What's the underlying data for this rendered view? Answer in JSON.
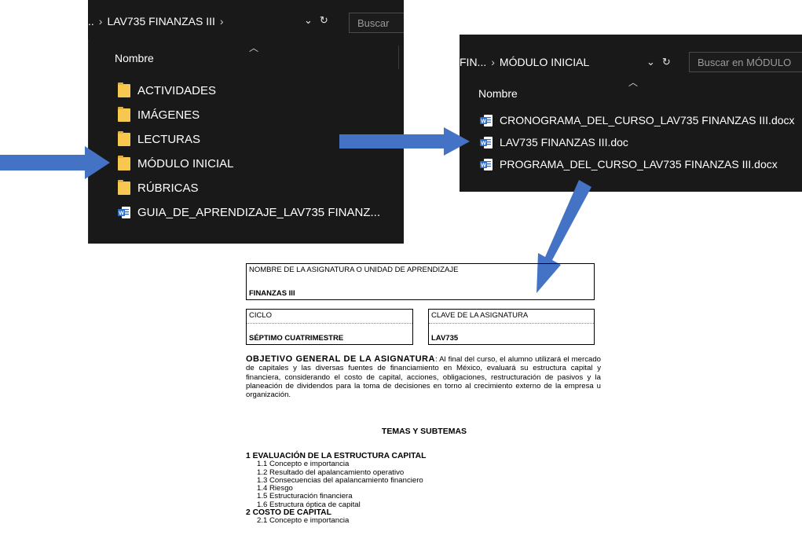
{
  "explorer1": {
    "breadcrumb_prev": "..",
    "breadcrumb_current": "LAV735 FINANZAS III",
    "search_placeholder": "Buscar",
    "column_name": "Nombre",
    "items": [
      {
        "label": "ACTIVIDADES",
        "icon": "folder-icon"
      },
      {
        "label": "IMÁGENES",
        "icon": "folder-icon"
      },
      {
        "label": "LECTURAS",
        "icon": "folder-icon"
      },
      {
        "label": "MÓDULO INICIAL",
        "icon": "folder-icon"
      },
      {
        "label": "RÚBRICAS",
        "icon": "folder-icon"
      },
      {
        "label": "GUIA_DE_APRENDIZAJE_LAV735 FINANZ...",
        "icon": "word-document-icon"
      }
    ]
  },
  "explorer2": {
    "breadcrumb_prev": "FIN...",
    "breadcrumb_current": "MÓDULO INICIAL",
    "search_placeholder": "Buscar en MÓDULO",
    "column_name": "Nombre",
    "items": [
      {
        "label": "CRONOGRAMA_DEL_CURSO_LAV735 FINANZAS III.docx",
        "icon": "word-document-icon"
      },
      {
        "label": "LAV735 FINANZAS III.doc",
        "icon": "word-document-icon"
      },
      {
        "label": "PROGRAMA_DEL_CURSO_LAV735 FINANZAS III.docx",
        "icon": "word-document-icon"
      }
    ]
  },
  "document": {
    "subject_label": "NOMBRE DE LA ASIGNATURA O UNIDAD DE APRENDIZAJE",
    "subject_value": "FINANZAS III",
    "cycle_label": "CICLO",
    "cycle_value": "SÉPTIMO CUATRIMESTRE",
    "code_label": "CLAVE DE LA ASIGNATURA",
    "code_value": "LAV735",
    "objective_heading": "OBJETIVO GENERAL DE LA ASIGNATURA",
    "objective_text": ": Al final del curso, el alumno utilizará el mercado de capitales y las diversas fuentes de financiamiento en México, evaluará su estructura capital y financiera, considerando el costo de capital, acciones, obligaciones, restructuración de pasivos y la planeación de dividendos para la toma de decisiones en torno al crecimiento externo de la empresa u organización.",
    "topics_title": "TEMAS Y SUBTEMAS",
    "topics": [
      {
        "text": "1  EVALUACIÓN DE LA ESTRUCTURA CAPITAL",
        "main": true
      },
      {
        "text": "1.1  Concepto e importancia",
        "main": false
      },
      {
        "text": "1.2  Resultado del apalancamiento operativo",
        "main": false
      },
      {
        "text": "1.3  Consecuencias del apalancamiento financiero",
        "main": false
      },
      {
        "text": "1.4  Riesgo",
        "main": false
      },
      {
        "text": "1.5  Estructuración financiera",
        "main": false
      },
      {
        "text": "1.6  Estructura óptica de capital",
        "main": false
      },
      {
        "text": "2  COSTO DE CAPITAL",
        "main": true
      },
      {
        "text": "2.1  Concepto e importancia",
        "main": false
      }
    ]
  },
  "colors": {
    "explorer_bg": "#191919",
    "folder": "#f6c84f",
    "word_blue": "#2b6cc4",
    "arrow": "#4472c4"
  }
}
